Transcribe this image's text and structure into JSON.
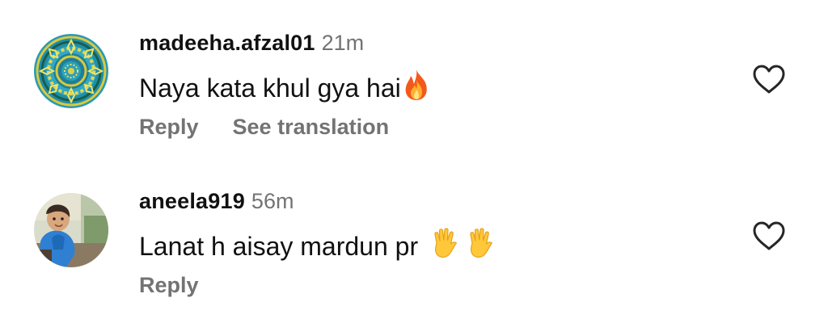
{
  "comments": [
    {
      "username": "madeeha.afzal01",
      "time": "21m",
      "text": "Naya kata khul gya hai",
      "emoji": "fire",
      "actions": [
        "Reply",
        "See translation"
      ]
    },
    {
      "username": "aneela919",
      "time": "56m",
      "text": "Lanat h aisay mardun pr",
      "emoji": "raised-hand x2",
      "actions": [
        "Reply"
      ]
    }
  ],
  "icons": {
    "like": "heart-outline-icon",
    "emoji_1": "fire-emoji-icon",
    "emoji_2": "raised-hand-emoji-icon"
  },
  "colors": {
    "username": "#111111",
    "secondary": "#737373",
    "text": "#111111",
    "background": "#ffffff"
  }
}
